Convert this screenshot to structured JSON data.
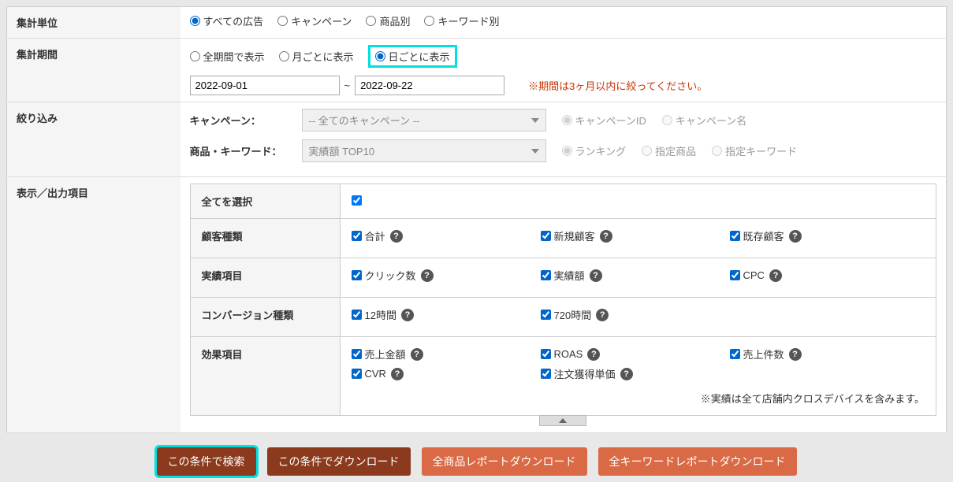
{
  "rows": {
    "unit": {
      "label": "集計単位",
      "options": [
        "すべての広告",
        "キャンペーン",
        "商品別",
        "キーワード別"
      ],
      "selected": 0
    },
    "period": {
      "label": "集計期間",
      "options": [
        "全期間で表示",
        "月ごとに表示",
        "日ごとに表示"
      ],
      "selected": 2,
      "date_from": "2022-09-01",
      "date_to": "2022-09-22",
      "tilde": "~",
      "warning": "※期間は3ヶ月以内に絞ってください。"
    },
    "filter": {
      "label": "絞り込み",
      "campaign": {
        "label": "キャンペーン：",
        "placeholder": "-- 全てのキャンペーン --",
        "sub_options": [
          "キャンペーンID",
          "キャンペーン名"
        ],
        "sub_selected": 0
      },
      "product": {
        "label": "商品・キーワード：",
        "placeholder": "実績額 TOP10",
        "sub_options": [
          "ランキング",
          "指定商品",
          "指定キーワード"
        ],
        "sub_selected": 0
      }
    },
    "output": {
      "label": "表示／出力項目",
      "select_all": "全てを選択",
      "groups": [
        {
          "header": "顧客種類",
          "items": [
            "合計",
            "新規顧客",
            "既存顧客"
          ]
        },
        {
          "header": "実績項目",
          "items": [
            "クリック数",
            "実績額",
            "CPC"
          ]
        },
        {
          "header": "コンバージョン種類",
          "items": [
            "12時間",
            "720時間"
          ]
        },
        {
          "header": "効果項目",
          "items": [
            "売上金額",
            "ROAS",
            "売上件数",
            "CVR",
            "注文獲得単価"
          ]
        }
      ],
      "note": "※実績は全て店舗内クロスデバイスを含みます。"
    }
  },
  "buttons": {
    "search": "この条件で検索",
    "download": "この条件でダウンロード",
    "all_products": "全商品レポートダウンロード",
    "all_keywords": "全キーワードレポートダウンロード"
  }
}
